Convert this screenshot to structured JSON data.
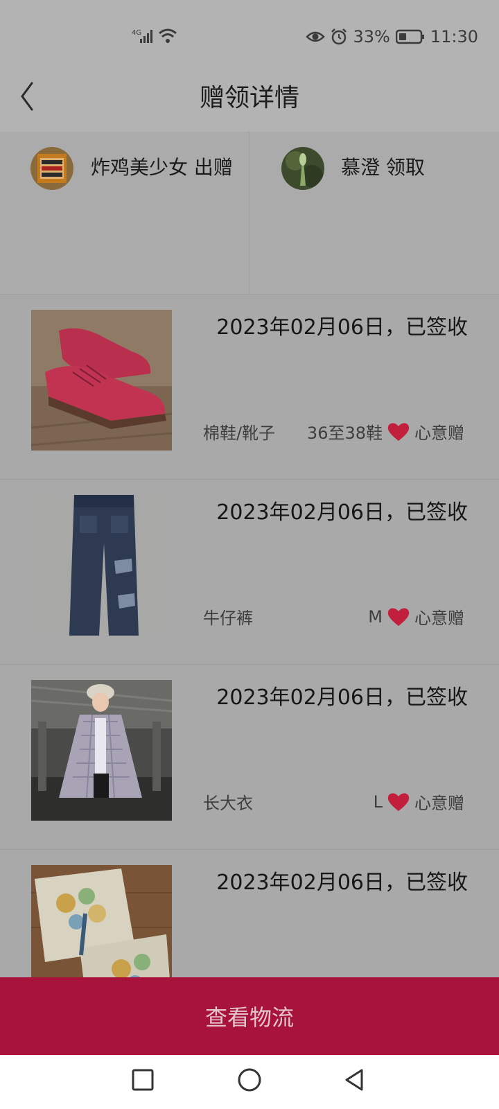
{
  "status_bar": {
    "network": "4G",
    "battery": "33%",
    "time": "11:30"
  },
  "header": {
    "title": "赠领详情"
  },
  "users": {
    "giver": {
      "name": "炸鸡美少女",
      "action": "出赠"
    },
    "receiver": {
      "name": "慕澄",
      "action": "领取"
    }
  },
  "items": [
    {
      "date_status": "2023年02月06日，已签收",
      "name": "棉鞋/靴子",
      "size": "36至38鞋",
      "tag": "心意赠",
      "thumb": "red-boots"
    },
    {
      "date_status": "2023年02月06日，已签收",
      "name": "牛仔裤",
      "size": "M",
      "tag": "心意赠",
      "thumb": "jeans"
    },
    {
      "date_status": "2023年02月06日，已签收",
      "name": "长大衣",
      "size": "L",
      "tag": "心意赠",
      "thumb": "plaid-coat"
    },
    {
      "date_status": "2023年02月06日，已签收",
      "name": "",
      "size": "",
      "tag": "",
      "thumb": "embroidered-cushion"
    }
  ],
  "footer": {
    "button_label": "查看物流"
  },
  "colors": {
    "accent": "#a7133b",
    "heart": "#c21f3c"
  }
}
